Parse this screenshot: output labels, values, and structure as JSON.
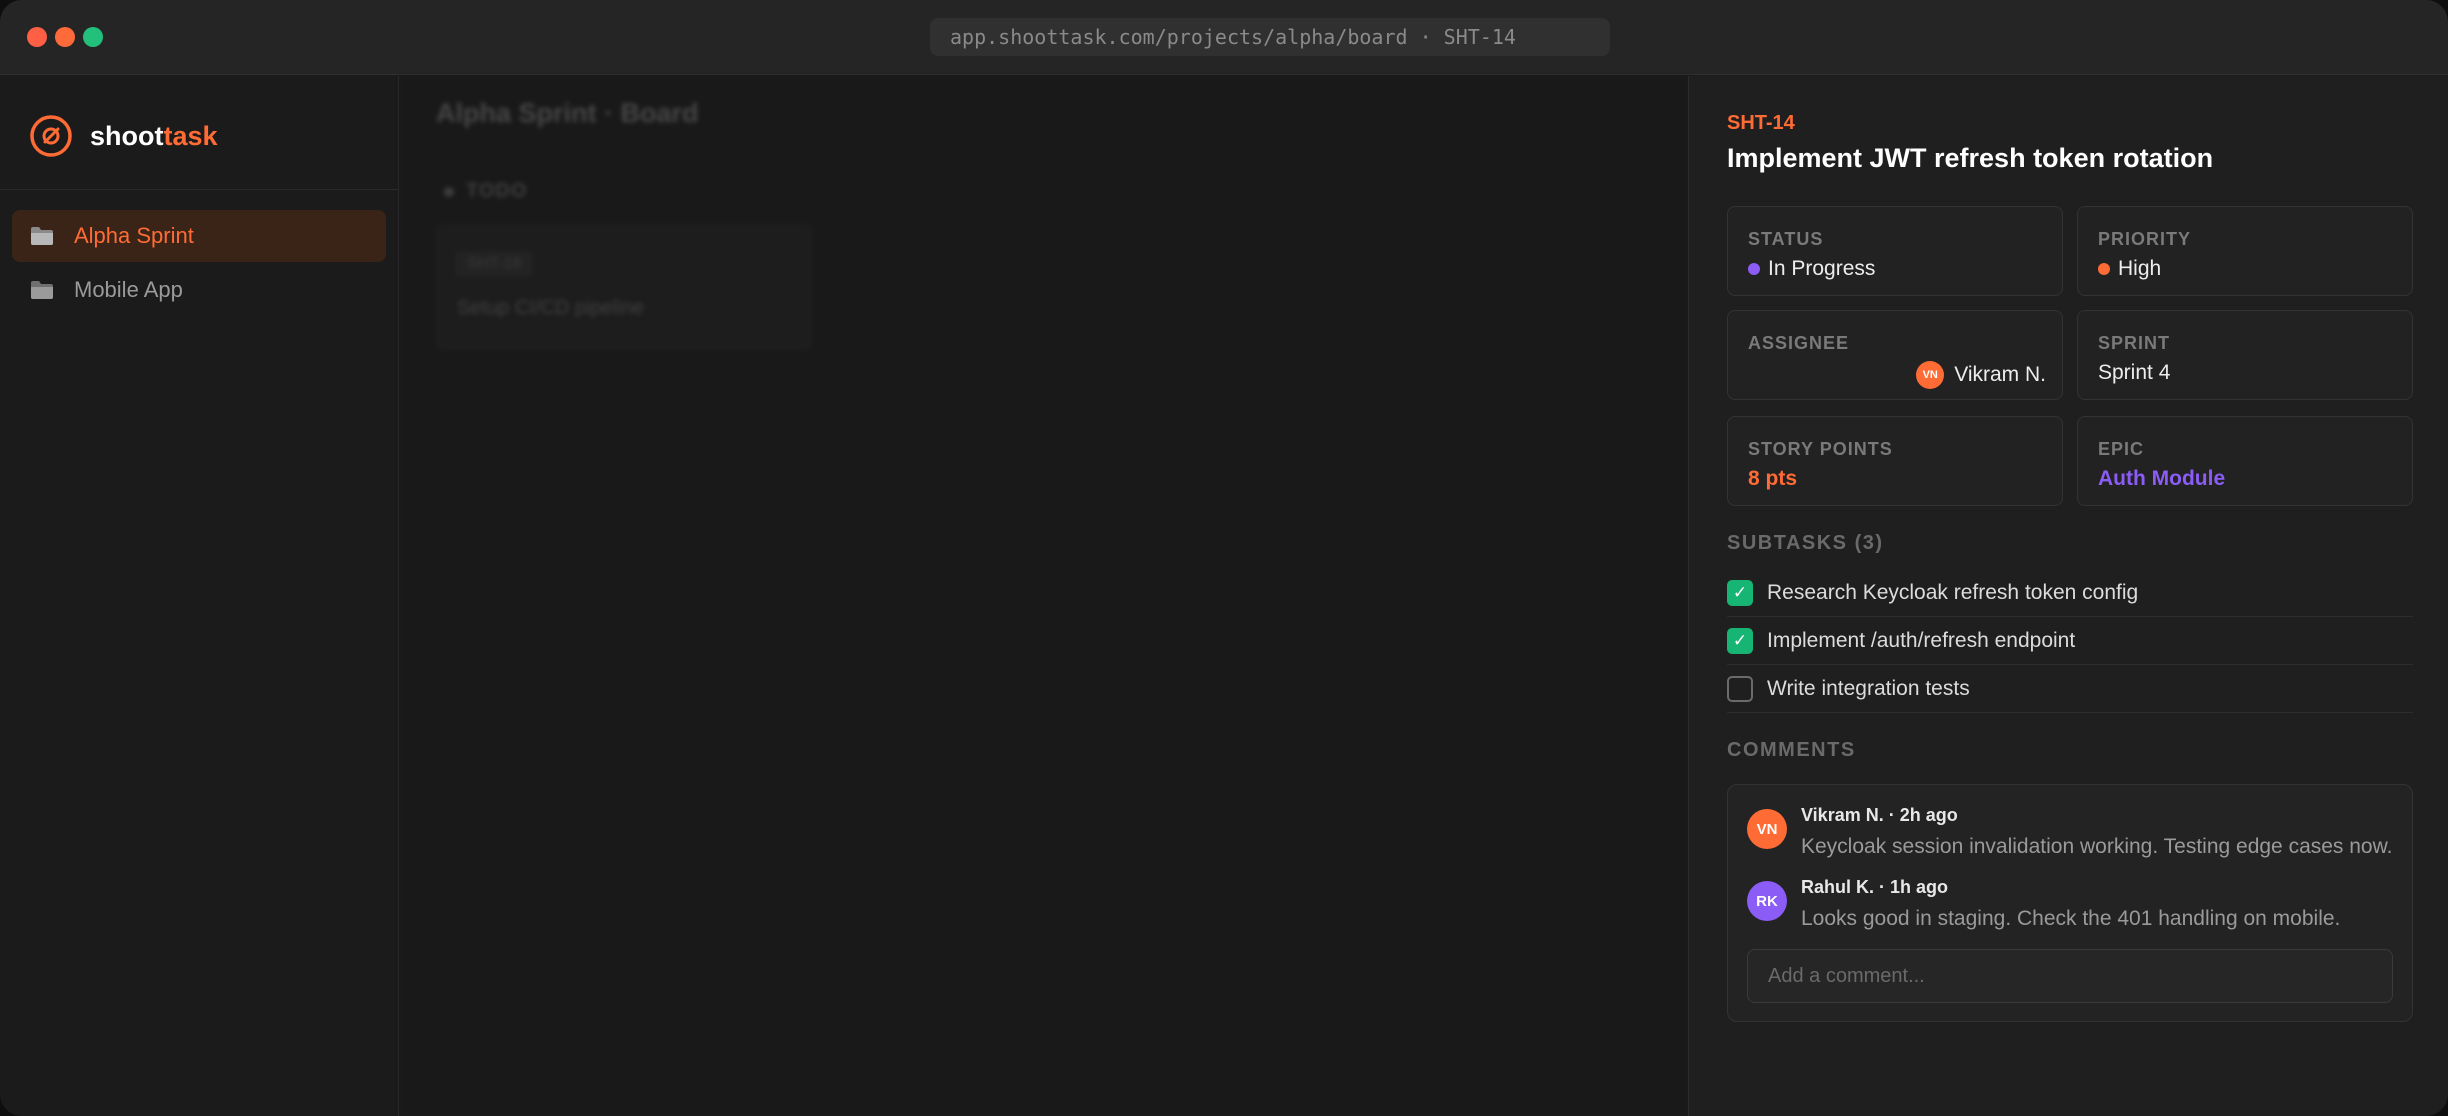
{
  "browser": {
    "url": "app.shoottask.com/projects/alpha/board · SHT-14"
  },
  "brand": {
    "name_part1": "shoot",
    "name_part2": "task",
    "accent_color": "#ff6b35"
  },
  "sidebar": {
    "items": [
      {
        "label": "Alpha Sprint",
        "icon": "folder-icon",
        "active": true
      },
      {
        "label": "Mobile App",
        "icon": "folder-icon",
        "active": false
      }
    ]
  },
  "board": {
    "title": "Alpha Sprint · Board",
    "columns": [
      {
        "label": "TODO",
        "cards": [
          {
            "id": "SHT-18",
            "title": "Setup CI/CD pipeline"
          }
        ]
      }
    ]
  },
  "issue": {
    "id": "SHT-14",
    "title": "Implement JWT refresh token rotation",
    "fields": {
      "status": {
        "label": "STATUS",
        "value": "In Progress",
        "color": "#8b5cf6"
      },
      "priority": {
        "label": "PRIORITY",
        "value": "High",
        "color": "#ff6b35"
      },
      "assignee": {
        "label": "ASSIGNEE",
        "value": "Vikram N.",
        "initials": "VN"
      },
      "sprint": {
        "label": "SPRINT",
        "value": "Sprint 4"
      },
      "story_points": {
        "label": "STORY POINTS",
        "value": "8 pts",
        "color": "#ff6b35"
      },
      "epic": {
        "label": "EPIC",
        "value": "Auth Module",
        "color": "#8b5cf6"
      }
    },
    "subtasks_label": "SUBTASKS (3)",
    "subtasks": [
      {
        "text": "Research Keycloak refresh token config",
        "done": true
      },
      {
        "text": "Implement /auth/refresh endpoint",
        "done": true
      },
      {
        "text": "Write integration tests",
        "done": false
      }
    ],
    "check_glyph": "✓",
    "comments_label": "COMMENTS",
    "comments": [
      {
        "initials": "VN",
        "meta": "Vikram N. · 2h ago",
        "text": "Keycloak session invalidation working. Testing edge cases now.",
        "color": "#ff6b35"
      },
      {
        "initials": "RK",
        "meta": "Rahul K. · 1h ago",
        "text": "Looks good in staging. Check the 401 handling on mobile.",
        "color": "#8b5cf6"
      }
    ],
    "comment_placeholder": "Add a comment..."
  }
}
